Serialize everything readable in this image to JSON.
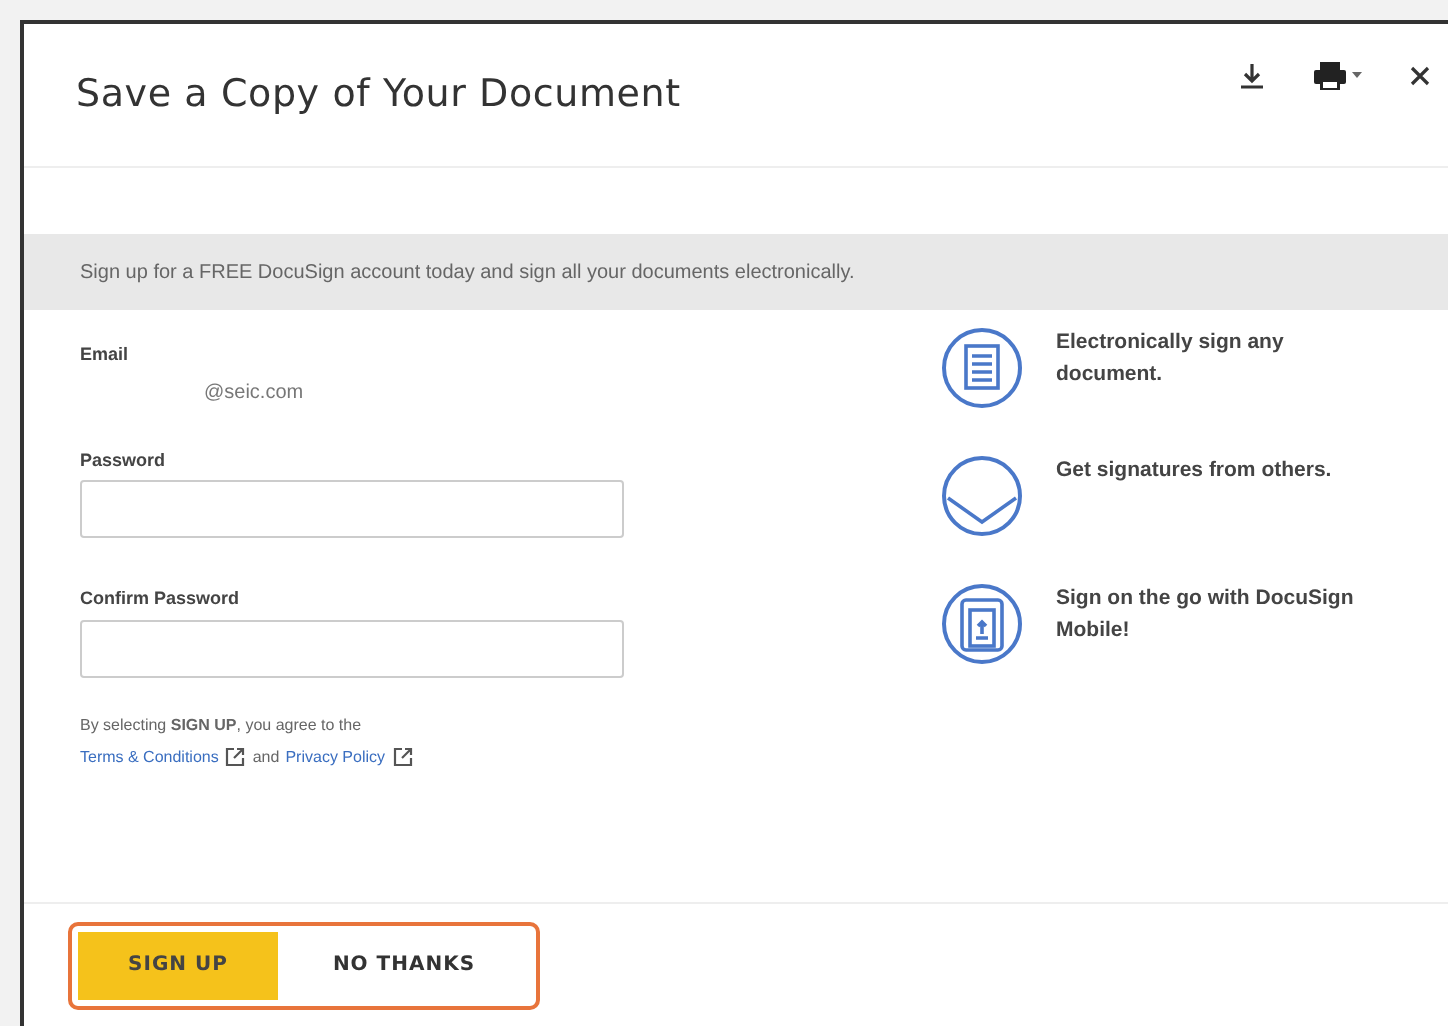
{
  "dialog": {
    "title": "Save a Copy of Your Document"
  },
  "toolbar": [
    {
      "kind": "download"
    },
    {
      "kind": "print"
    },
    {
      "kind": "close"
    }
  ],
  "banner": "Sign up for a FREE DocuSign account today and sign all your documents electronically.",
  "form": {
    "email_label": "Email",
    "email_value": "@seic.com",
    "password_label": "Password",
    "confirm_label": "Confirm Password",
    "consent": "By selecting **SIGN UP**, you agree to the",
    "links": [
      {
        "label": "Terms & Conditions"
      },
      {
        "label": "Privacy Policy"
      }
    ],
    "link_joiner": "and"
  },
  "features": [
    {
      "kind": "document",
      "text": "Electronically sign any document."
    },
    {
      "kind": "envelope",
      "text": "Get signatures from others."
    },
    {
      "kind": "mobile",
      "text": "Sign on the go with DocuSign Mobile!"
    }
  ],
  "buttons": [
    {
      "label": "SIGN UP",
      "kind": "primary"
    },
    {
      "label": "NO THANKS",
      "kind": "secondary"
    }
  ],
  "footer": {
    "focused": true
  }
}
